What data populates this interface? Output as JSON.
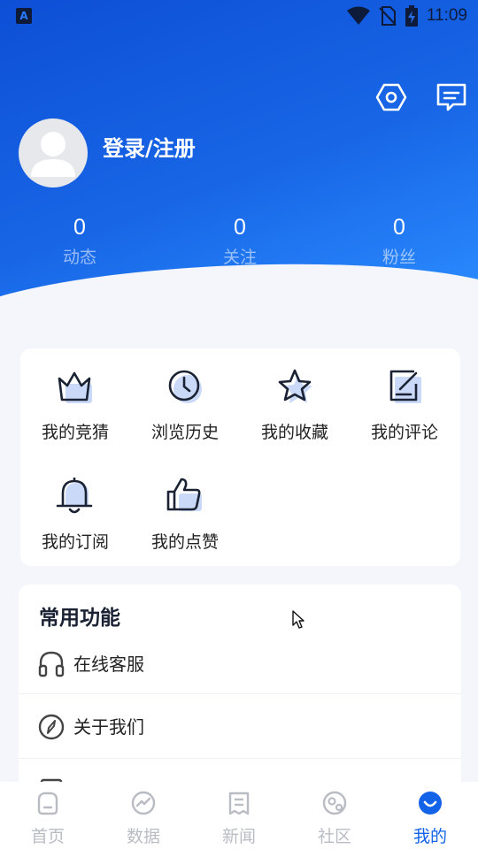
{
  "status_bar": {
    "time": "11:09"
  },
  "header": {
    "login_label": "登录/注册"
  },
  "stats": [
    {
      "value": "0",
      "label": "动态"
    },
    {
      "value": "0",
      "label": "关注"
    },
    {
      "value": "0",
      "label": "粉丝"
    }
  ],
  "grid": {
    "items": [
      {
        "label": "我的竞猜",
        "icon": "crown-icon"
      },
      {
        "label": "浏览历史",
        "icon": "clock-icon"
      },
      {
        "label": "我的收藏",
        "icon": "star-icon"
      },
      {
        "label": "我的评论",
        "icon": "edit-icon"
      },
      {
        "label": "我的订阅",
        "icon": "bell-icon"
      },
      {
        "label": "我的点赞",
        "icon": "thumbs-up-icon"
      }
    ]
  },
  "common": {
    "title": "常用功能",
    "rows": [
      {
        "label": "在线客服",
        "icon": "headset-icon"
      },
      {
        "label": "关于我们",
        "icon": "compass-icon"
      },
      {
        "label": "",
        "icon": "document-icon"
      }
    ]
  },
  "bottom_nav": {
    "items": [
      {
        "label": "首页",
        "icon": "home-icon",
        "active": false
      },
      {
        "label": "数据",
        "icon": "chart-icon",
        "active": false
      },
      {
        "label": "新闻",
        "icon": "news-icon",
        "active": false
      },
      {
        "label": "社区",
        "icon": "community-icon",
        "active": false
      },
      {
        "label": "我的",
        "icon": "profile-icon",
        "active": true
      }
    ]
  },
  "colors": {
    "primary": "#1363e8",
    "hero_start": "#0d4fd6",
    "hero_end": "#2b8cff",
    "inactive_nav": "#b9bcc3"
  }
}
